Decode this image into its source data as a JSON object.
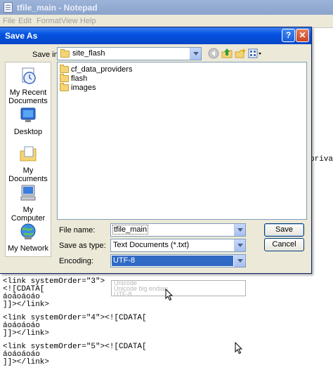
{
  "notepad": {
    "title": "tfile_main - Notepad",
    "menu": [
      "File",
      "Edit",
      "Format",
      "View",
      "Help"
    ],
    "side_text": "priva",
    "code_lines": [
      "<link systemOrder=\"3\">",
      "<![CDATA[",
      "áoáoáoáo",
      "]]></link>",
      "",
      "<link systemOrder=\"4\"><![CDATA[",
      "áoáoáoáo",
      "]]></link>",
      "",
      "<link systemOrder=\"5\"><![CDATA[",
      "áoáoáoáo",
      "]]></link>"
    ]
  },
  "dialog": {
    "title": "Save As",
    "help_symbol": "?",
    "close_symbol": "✕",
    "save_in_label": "Save in:",
    "save_in_value": "site_flash",
    "places": [
      "My Recent Documents",
      "Desktop",
      "My Documents",
      "My Computer",
      "My Network"
    ],
    "files": [
      "cf_data_providers",
      "flash",
      "images"
    ],
    "file_name_label": "File name:",
    "file_name_value": "tfile_main",
    "save_as_type_label": "Save as type:",
    "save_as_type_value": "Text Documents (*.txt)",
    "encoding_label": "Encoding:",
    "encoding_value": "UTF-8",
    "encoding_options": [
      "Unicode",
      "Unicode big endian",
      "UTF-8"
    ],
    "save_button": "Save",
    "cancel_button": "Cancel"
  }
}
